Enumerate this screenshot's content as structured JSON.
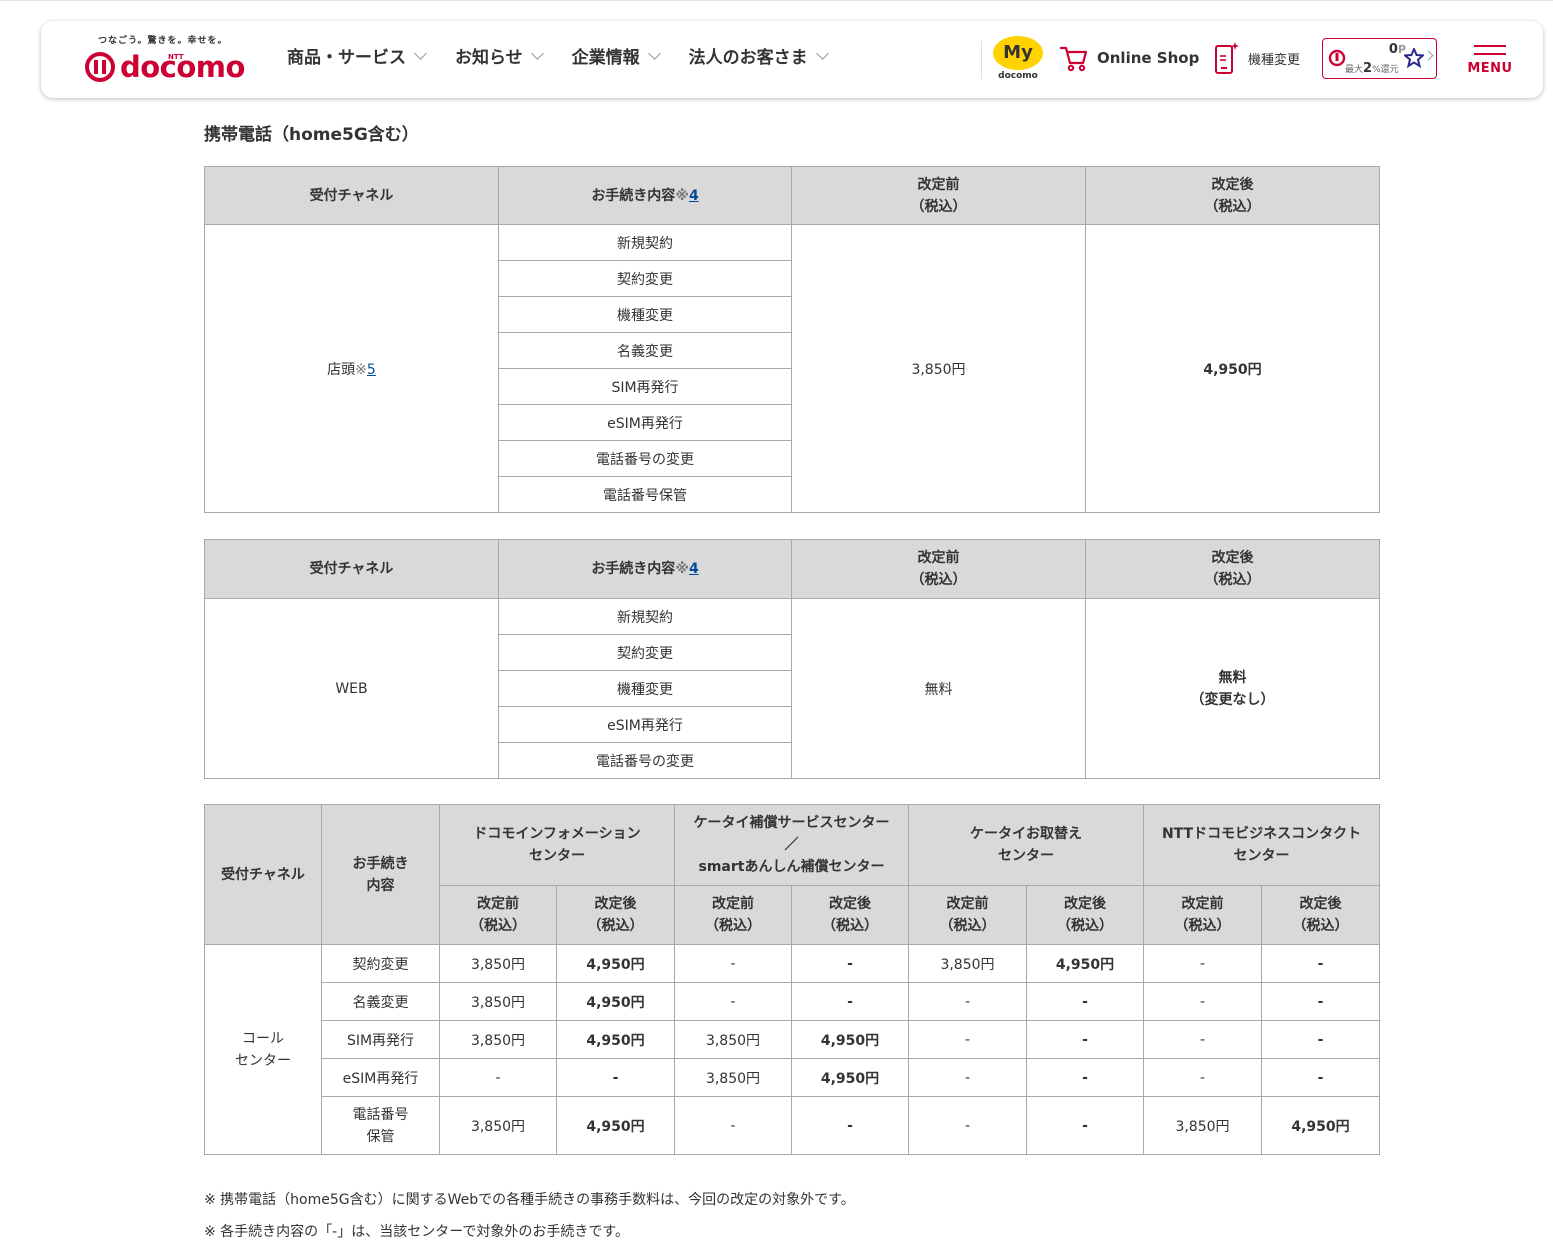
{
  "header": {
    "tagline": "つなごう。驚きを。幸せを。",
    "ntt": "NTT",
    "brand": "docomo",
    "brand_color": "#cc0033",
    "nav": [
      {
        "label": "商品・サービス"
      },
      {
        "label": "お知らせ"
      },
      {
        "label": "企業情報"
      },
      {
        "label": "法人のお客さま"
      }
    ],
    "mydocomo": {
      "my": "My",
      "sub": "docomo",
      "color": "#ffd200"
    },
    "online_shop": "Online Shop",
    "kishu": "機種変更",
    "points": {
      "value": "0",
      "unit": "P",
      "sub_prefix": "最大",
      "sub_num": "2",
      "sub_suffix": "%還元"
    },
    "menu": "MENU"
  },
  "section_title": "携帯電話（home5G含む）",
  "table1": {
    "headers": {
      "channel": "受付チャネル",
      "content": "お手続き内容",
      "content_note_mark": "※",
      "content_note_num": "4",
      "before_1": "改定前",
      "before_2": "（税込）",
      "after_1": "改定後",
      "after_2": "（税込）"
    },
    "channel": "店頭",
    "channel_note_mark": "※",
    "channel_note_num": "5",
    "items": [
      "新規契約",
      "契約変更",
      "機種変更",
      "名義変更",
      "SIM再発行",
      "eSIM再発行",
      "電話番号の変更",
      "電話番号保管"
    ],
    "before": "3,850円",
    "after": "4,950円"
  },
  "table2": {
    "headers": {
      "channel": "受付チャネル",
      "content": "お手続き内容",
      "content_note_mark": "※",
      "content_note_num": "4",
      "before_1": "改定前",
      "before_2": "（税込）",
      "after_1": "改定後",
      "after_2": "（税込）"
    },
    "channel": "WEB",
    "items": [
      "新規契約",
      "契約変更",
      "機種変更",
      "eSIM再発行",
      "電話番号の変更"
    ],
    "before": "無料",
    "after_1": "無料",
    "after_2": "（変更なし）"
  },
  "table3": {
    "headers": {
      "channel": "受付チャネル",
      "content_1": "お手続き",
      "content_2": "内容",
      "centers": [
        {
          "line1": "ドコモインフォメーション",
          "line2": "センター",
          "line3": ""
        },
        {
          "line1": "ケータイ補償サービスセンター",
          "line2": "／",
          "line3": "smartあんしん補償センター"
        },
        {
          "line1": "ケータイお取替え",
          "line2": "センター",
          "line3": ""
        },
        {
          "line1": "NTTドコモビジネスコンタクト",
          "line2": "センター",
          "line3": ""
        }
      ],
      "before_1": "改定前",
      "before_2": "（税込）",
      "after_1": "改定後",
      "after_2": "（税込）"
    },
    "channel_1": "コール",
    "channel_2": "センター",
    "rows": [
      {
        "label_1": "契約変更",
        "label_2": "",
        "cells": [
          "3,850円",
          "4,950円",
          "-",
          "-",
          "3,850円",
          "4,950円",
          "-",
          "-"
        ]
      },
      {
        "label_1": "名義変更",
        "label_2": "",
        "cells": [
          "3,850円",
          "4,950円",
          "-",
          "-",
          "-",
          "-",
          "-",
          "-"
        ]
      },
      {
        "label_1": "SIM再発行",
        "label_2": "",
        "cells": [
          "3,850円",
          "4,950円",
          "3,850円",
          "4,950円",
          "-",
          "-",
          "-",
          "-"
        ]
      },
      {
        "label_1": "eSIM再発行",
        "label_2": "",
        "cells": [
          "-",
          "-",
          "3,850円",
          "4,950円",
          "-",
          "-",
          "-",
          "-"
        ]
      },
      {
        "label_1": "電話番号",
        "label_2": "保管",
        "cells": [
          "3,850円",
          "4,950円",
          "-",
          "-",
          "-",
          "-",
          "3,850円",
          "4,950円"
        ]
      }
    ]
  },
  "notes": [
    "※ 携帯電話（home5G含む）に関するWebでの各種手続きの事務手数料は、今回の改定の対象外です。",
    "※ 各手続き内容の「-」は、当該センターで対象外のお手続きです。"
  ],
  "colors": {
    "header_bg": "#d9d9d9",
    "border": "#a9a9a9",
    "link": "#004c99"
  }
}
